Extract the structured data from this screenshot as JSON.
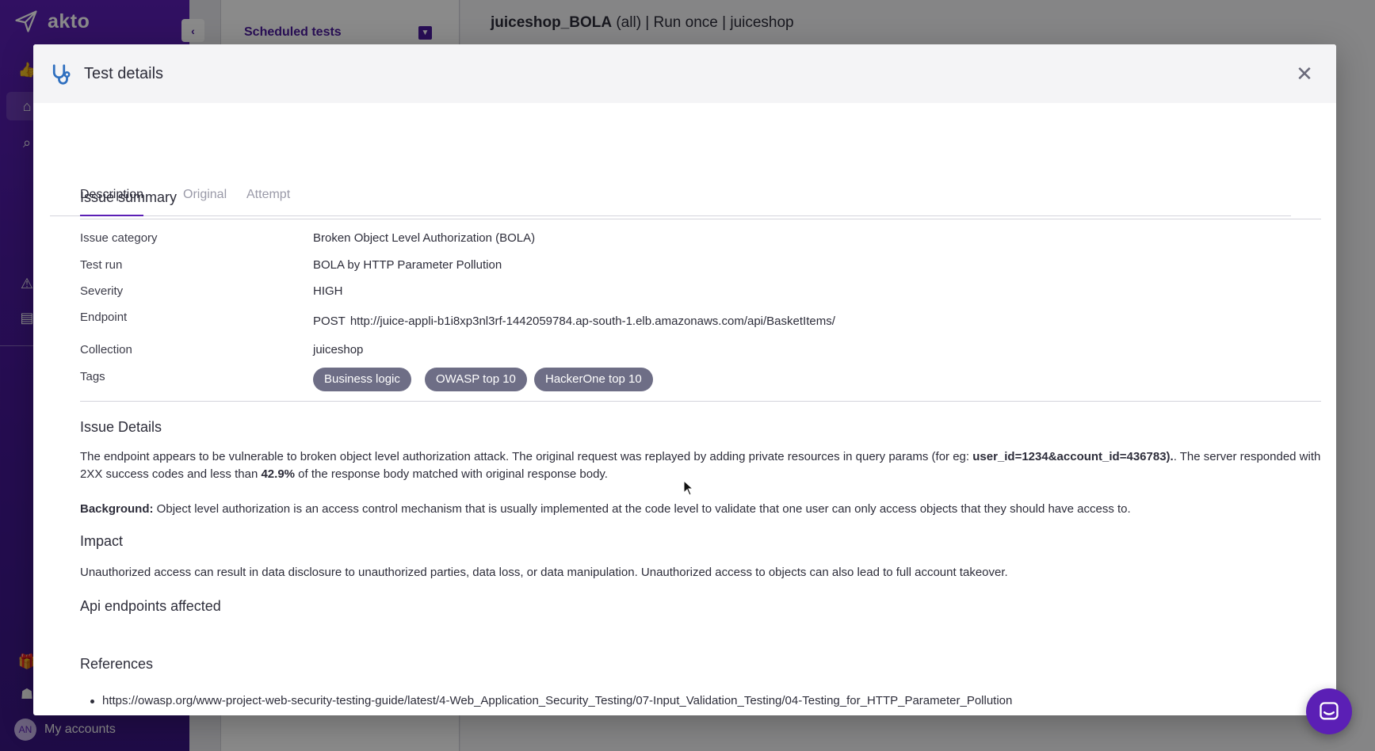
{
  "app": {
    "brand": "akto",
    "my_accounts_label": "My accounts",
    "avatar_initials": "AN",
    "subnav_title": "Scheduled tests",
    "main_title_bold": "juiceshop_BOLA",
    "main_title_rest": " (all) | Run once | juiceshop"
  },
  "modal": {
    "title": "Test details",
    "tabs": [
      {
        "label": "Description",
        "active": true
      },
      {
        "label": "Original",
        "active": false
      },
      {
        "label": "Attempt",
        "active": false
      }
    ],
    "issue_summary": {
      "heading": "Issue summary",
      "rows": [
        {
          "label": "Issue category",
          "value": "Broken Object Level Authorization (BOLA)"
        },
        {
          "label": "Test run",
          "value": "BOLA by HTTP Parameter Pollution"
        },
        {
          "label": "Severity",
          "value": "HIGH"
        },
        {
          "label": "Endpoint",
          "method": "POST",
          "value": "http://juice-appli-b1i8xp3nl3rf-1442059784.ap-south-1.elb.amazonaws.com/api/BasketItems/"
        },
        {
          "label": "Collection",
          "value": "juiceshop"
        },
        {
          "label": "Tags",
          "tags": [
            "Business logic",
            "OWASP top 10",
            "HackerOne top 10"
          ]
        }
      ]
    },
    "issue_details": {
      "heading": "Issue Details",
      "p1_a": "The endpoint appears to be vulnerable to broken object level authorization attack. The original request was replayed by adding private resources in query params (for eg: ",
      "p1_b": "user_id=1234&account_id=436783).",
      "p1_c": ". The server responded with 2XX success codes and less than ",
      "p1_d": "42.9%",
      "p1_e": " of the response body matched with original response body.",
      "bg_label": "Background:",
      "bg_text": " Object level authorization is an access control mechanism that is usually implemented at the code level to validate that one user can only access objects that they should have access to."
    },
    "impact": {
      "heading": "Impact",
      "text": "Unauthorized access can result in data disclosure to unauthorized parties, data loss, or data manipulation. Unauthorized access to objects can also lead to full account takeover."
    },
    "api_endpoints_heading": "Api endpoints affected",
    "references": {
      "heading": "References",
      "items": [
        "https://owasp.org/www-project-web-security-testing-guide/latest/4-Web_Application_Security_Testing/07-Input_Validation_Testing/04-Testing_for_HTTP_Parameter_Pollution"
      ]
    }
  },
  "colors": {
    "brand": "#5b1fb5",
    "tag_bg": "#6e6e86"
  }
}
